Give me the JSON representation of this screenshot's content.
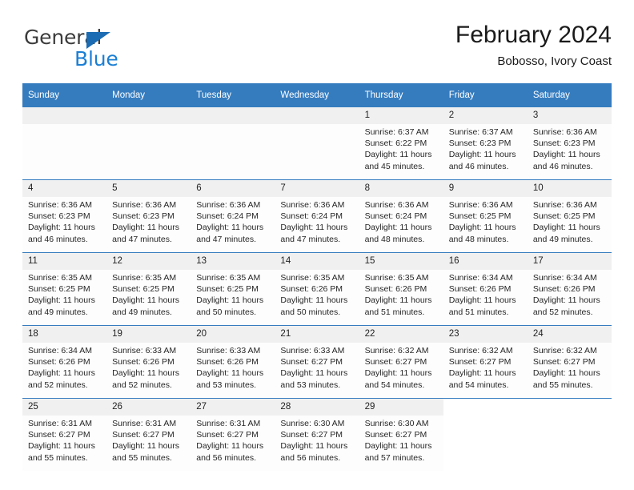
{
  "logo": {
    "word_one": "General",
    "word_two": "Blue",
    "triangle_color": "#1b6cb3",
    "blue_color": "#1b7fd4"
  },
  "header": {
    "title": "February 2024",
    "subtitle": "Bobosso, Ivory Coast"
  },
  "theme": {
    "header_blue": "#357cbf",
    "daynum_gray": "#f0f0f0",
    "separator_blue": "#357cbf"
  },
  "weekdays": [
    "Sunday",
    "Monday",
    "Tuesday",
    "Wednesday",
    "Thursday",
    "Friday",
    "Saturday"
  ],
  "labels": {
    "sunrise": "Sunrise:",
    "sunset": "Sunset:",
    "daylight": "Daylight:"
  },
  "weeks": [
    [
      {
        "day": "",
        "empty": true
      },
      {
        "day": "",
        "empty": true
      },
      {
        "day": "",
        "empty": true
      },
      {
        "day": "",
        "empty": true
      },
      {
        "day": "1",
        "sunrise": "Sunrise: 6:37 AM",
        "sunset": "Sunset: 6:22 PM",
        "daylight": "Daylight: 11 hours and 45 minutes."
      },
      {
        "day": "2",
        "sunrise": "Sunrise: 6:37 AM",
        "sunset": "Sunset: 6:23 PM",
        "daylight": "Daylight: 11 hours and 46 minutes."
      },
      {
        "day": "3",
        "sunrise": "Sunrise: 6:36 AM",
        "sunset": "Sunset: 6:23 PM",
        "daylight": "Daylight: 11 hours and 46 minutes."
      }
    ],
    [
      {
        "day": "4",
        "sunrise": "Sunrise: 6:36 AM",
        "sunset": "Sunset: 6:23 PM",
        "daylight": "Daylight: 11 hours and 46 minutes."
      },
      {
        "day": "5",
        "sunrise": "Sunrise: 6:36 AM",
        "sunset": "Sunset: 6:23 PM",
        "daylight": "Daylight: 11 hours and 47 minutes."
      },
      {
        "day": "6",
        "sunrise": "Sunrise: 6:36 AM",
        "sunset": "Sunset: 6:24 PM",
        "daylight": "Daylight: 11 hours and 47 minutes."
      },
      {
        "day": "7",
        "sunrise": "Sunrise: 6:36 AM",
        "sunset": "Sunset: 6:24 PM",
        "daylight": "Daylight: 11 hours and 47 minutes."
      },
      {
        "day": "8",
        "sunrise": "Sunrise: 6:36 AM",
        "sunset": "Sunset: 6:24 PM",
        "daylight": "Daylight: 11 hours and 48 minutes."
      },
      {
        "day": "9",
        "sunrise": "Sunrise: 6:36 AM",
        "sunset": "Sunset: 6:25 PM",
        "daylight": "Daylight: 11 hours and 48 minutes."
      },
      {
        "day": "10",
        "sunrise": "Sunrise: 6:36 AM",
        "sunset": "Sunset: 6:25 PM",
        "daylight": "Daylight: 11 hours and 49 minutes."
      }
    ],
    [
      {
        "day": "11",
        "sunrise": "Sunrise: 6:35 AM",
        "sunset": "Sunset: 6:25 PM",
        "daylight": "Daylight: 11 hours and 49 minutes."
      },
      {
        "day": "12",
        "sunrise": "Sunrise: 6:35 AM",
        "sunset": "Sunset: 6:25 PM",
        "daylight": "Daylight: 11 hours and 49 minutes."
      },
      {
        "day": "13",
        "sunrise": "Sunrise: 6:35 AM",
        "sunset": "Sunset: 6:25 PM",
        "daylight": "Daylight: 11 hours and 50 minutes."
      },
      {
        "day": "14",
        "sunrise": "Sunrise: 6:35 AM",
        "sunset": "Sunset: 6:26 PM",
        "daylight": "Daylight: 11 hours and 50 minutes."
      },
      {
        "day": "15",
        "sunrise": "Sunrise: 6:35 AM",
        "sunset": "Sunset: 6:26 PM",
        "daylight": "Daylight: 11 hours and 51 minutes."
      },
      {
        "day": "16",
        "sunrise": "Sunrise: 6:34 AM",
        "sunset": "Sunset: 6:26 PM",
        "daylight": "Daylight: 11 hours and 51 minutes."
      },
      {
        "day": "17",
        "sunrise": "Sunrise: 6:34 AM",
        "sunset": "Sunset: 6:26 PM",
        "daylight": "Daylight: 11 hours and 52 minutes."
      }
    ],
    [
      {
        "day": "18",
        "sunrise": "Sunrise: 6:34 AM",
        "sunset": "Sunset: 6:26 PM",
        "daylight": "Daylight: 11 hours and 52 minutes."
      },
      {
        "day": "19",
        "sunrise": "Sunrise: 6:33 AM",
        "sunset": "Sunset: 6:26 PM",
        "daylight": "Daylight: 11 hours and 52 minutes."
      },
      {
        "day": "20",
        "sunrise": "Sunrise: 6:33 AM",
        "sunset": "Sunset: 6:26 PM",
        "daylight": "Daylight: 11 hours and 53 minutes."
      },
      {
        "day": "21",
        "sunrise": "Sunrise: 6:33 AM",
        "sunset": "Sunset: 6:27 PM",
        "daylight": "Daylight: 11 hours and 53 minutes."
      },
      {
        "day": "22",
        "sunrise": "Sunrise: 6:32 AM",
        "sunset": "Sunset: 6:27 PM",
        "daylight": "Daylight: 11 hours and 54 minutes."
      },
      {
        "day": "23",
        "sunrise": "Sunrise: 6:32 AM",
        "sunset": "Sunset: 6:27 PM",
        "daylight": "Daylight: 11 hours and 54 minutes."
      },
      {
        "day": "24",
        "sunrise": "Sunrise: 6:32 AM",
        "sunset": "Sunset: 6:27 PM",
        "daylight": "Daylight: 11 hours and 55 minutes."
      }
    ],
    [
      {
        "day": "25",
        "sunrise": "Sunrise: 6:31 AM",
        "sunset": "Sunset: 6:27 PM",
        "daylight": "Daylight: 11 hours and 55 minutes."
      },
      {
        "day": "26",
        "sunrise": "Sunrise: 6:31 AM",
        "sunset": "Sunset: 6:27 PM",
        "daylight": "Daylight: 11 hours and 55 minutes."
      },
      {
        "day": "27",
        "sunrise": "Sunrise: 6:31 AM",
        "sunset": "Sunset: 6:27 PM",
        "daylight": "Daylight: 11 hours and 56 minutes."
      },
      {
        "day": "28",
        "sunrise": "Sunrise: 6:30 AM",
        "sunset": "Sunset: 6:27 PM",
        "daylight": "Daylight: 11 hours and 56 minutes."
      },
      {
        "day": "29",
        "sunrise": "Sunrise: 6:30 AM",
        "sunset": "Sunset: 6:27 PM",
        "daylight": "Daylight: 11 hours and 57 minutes."
      },
      {
        "day": "",
        "blank": true
      },
      {
        "day": "",
        "blank": true
      }
    ]
  ]
}
